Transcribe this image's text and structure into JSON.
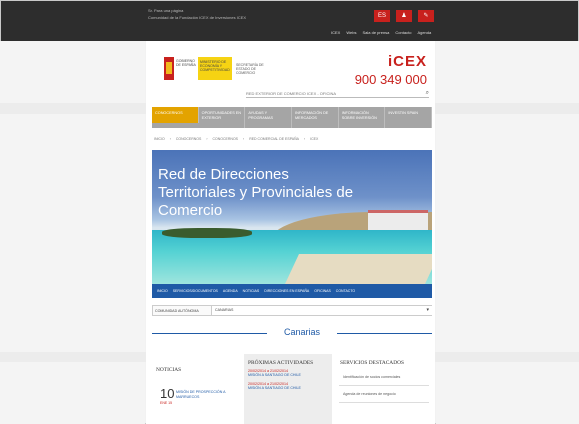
{
  "topbar": {
    "line1": "Sr. Para una página",
    "line2": "Comunidad de la Fundación ICEX de Inversiones ICEX",
    "lang_flag": "ES",
    "user_icon": "person-icon",
    "tool_icon": "wrench-icon",
    "links": [
      "ICEX",
      "Webs",
      "Sala de prensa",
      "Contacto",
      "Agenda"
    ]
  },
  "header": {
    "gov_line": "GOBIERNO DE ESPAÑA",
    "ministry": "MINISTERIO DE ECONOMÍA Y COMPETITIVIDAD",
    "secretary": "SECRETARÍA DE ESTADO DE COMERCIO",
    "brand": "iCEX",
    "phone": "900 349 000"
  },
  "search": {
    "placeholder": "RED EXTERIOR DE COMERCIO ICEX - OFICINA"
  },
  "nav": {
    "items": [
      "CONOCERNOS",
      "OPORTUNIDADES EN EXTERIOR",
      "AYUDAS Y PROGRAMAS",
      "INFORMACIÓN DE MERCADOS",
      "INFORMACIÓN SOBRE INVERSIÓN",
      "INVESTIN SPAIN"
    ],
    "active_index": 0
  },
  "breadcrumb": [
    "INICIO",
    "CONOCERNOS",
    "CONOCERNOS",
    "RED COMERCIAL DE ESPAÑA",
    "ICEX"
  ],
  "hero": {
    "title": "Red de Direcciones Territoriales y Provinciales de Comercio"
  },
  "subnav": {
    "items": [
      "INICIO",
      "SERVICIOS/DOCUMENTOS",
      "AGENDA",
      "NOTICIAS",
      "DIRECCIONES EN ESPAÑA",
      "OFICINAS",
      "CONTACTO"
    ]
  },
  "selector": {
    "label": "COMUNIDAD AUTÓNOMA",
    "value": "CANARIAS"
  },
  "section": {
    "title": "Canarias"
  },
  "columns": {
    "news_title": "NOTICIAS",
    "news_day": "10",
    "news_month": "ENE 15",
    "news_text": "MISIÓN DE PROSPECCIÓN A MARRUECOS",
    "activities_title": "PRÓXIMAS ACTIVIDADES",
    "activities": [
      {
        "date": "20/02/2014 a 21/02/2014",
        "name": "MISIÓN A SANTIAGO DE CHILE"
      },
      {
        "date": "20/02/2014 a 21/02/2014",
        "name": "MISIÓN A SANTIAGO DE CHILE"
      }
    ],
    "services_title": "SERVICIOS DESTACADOS",
    "services": [
      "Identificación de socios comerciales",
      "Agenda de reuniones de negocio"
    ]
  }
}
